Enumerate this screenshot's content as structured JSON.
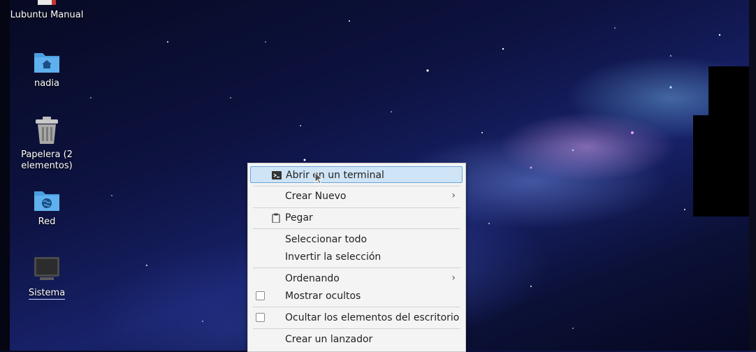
{
  "desktop": {
    "icons": [
      {
        "label": "Lubuntu Manual",
        "icon": "document-icon"
      },
      {
        "label": "nadia",
        "icon": "home-folder-icon"
      },
      {
        "label": "Papelera (2 elementos)",
        "icon": "trash-icon"
      },
      {
        "label": "Red",
        "icon": "network-folder-icon"
      },
      {
        "label": "Sistema",
        "icon": "computer-icon"
      }
    ]
  },
  "context_menu": {
    "items": [
      {
        "label": "Abrir en un terminal",
        "icon": "terminal-icon",
        "highlighted": true
      },
      {
        "label": "Crear Nuevo",
        "submenu": true
      },
      {
        "label": "Pegar",
        "icon": "clipboard-icon"
      },
      {
        "label": "Seleccionar todo"
      },
      {
        "label": "Invertir la selección"
      },
      {
        "label": "Ordenando",
        "submenu": true
      },
      {
        "label": "Mostrar ocultos",
        "checkbox": true,
        "checked": false
      },
      {
        "label": "Ocultar los elementos del escritorio",
        "checkbox": true,
        "checked": false
      },
      {
        "label": "Crear un lanzador"
      }
    ]
  },
  "colors": {
    "menu_background": "#f4f4f4",
    "highlight": "#cfe4f6",
    "highlight_border": "#6aa5d8",
    "folder_blue": "#4a9fe0"
  }
}
